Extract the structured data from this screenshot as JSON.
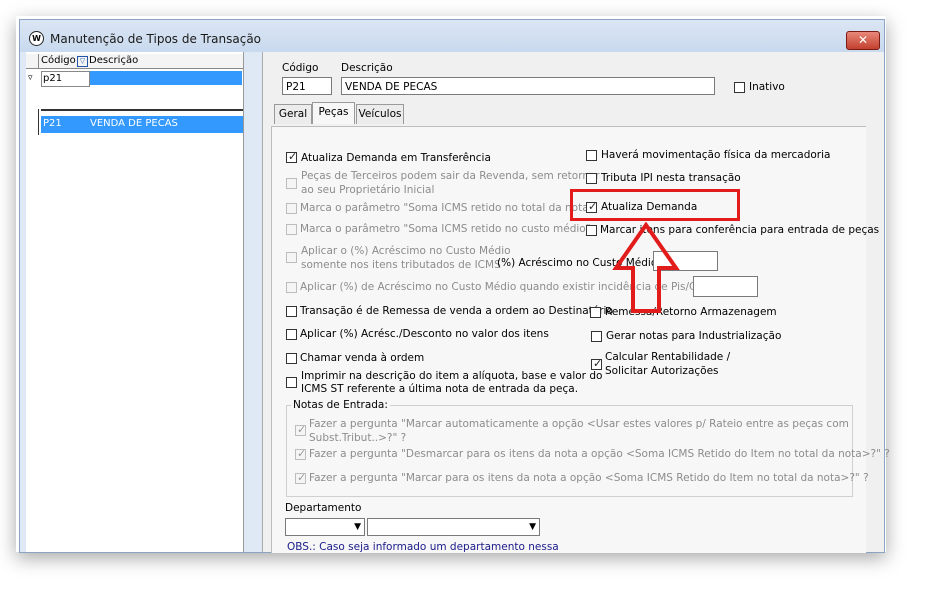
{
  "window": {
    "title": "Manutenção de Tipos de Transação",
    "close_label": "✕"
  },
  "list": {
    "col_codigo": "Código",
    "col_descricao": "Descrição",
    "filter_value": "p21",
    "rows": [
      {
        "codigo": "P21",
        "descricao": "VENDA DE PECAS"
      }
    ]
  },
  "header": {
    "codigo_label": "Código",
    "descricao_label": "Descrição",
    "codigo_value": "P21",
    "descricao_value": "VENDA DE PECAS",
    "inativo_label": "Inativo"
  },
  "tabs": [
    "Geral",
    "Peças",
    "Veículos"
  ],
  "active_tab": "Peças",
  "options": {
    "atualiza_transf": "Atualiza Demanda em Transferência",
    "pecas_terceiros_1": "Peças de Terceiros podem sair da Revenda, sem retornar",
    "pecas_terceiros_2": "ao seu Proprietário Inicial",
    "marca_soma_total": "Marca o parâmetro \"Soma ICMS retido no total da nota\"",
    "marca_soma_custo": "Marca o parâmetro \"Soma ICMS retido no custo médio\".",
    "aplicar_acresc_1": "Aplicar o (%) Acréscimo no Custo Médio",
    "aplicar_acresc_2": "somente nos itens tributados de ICMS",
    "acresc_custo_label": "(%) Acréscimo no Custo Médio:",
    "aplicar_pis": "Aplicar (%) de Acréscimo no Custo Médio quando existir incidência de Pis/Cofins:",
    "remessa_ordem": "Transação é de Remessa de venda a ordem ao Destinatário",
    "aplicar_desconto": "Aplicar (%) Acrésc./Desconto no valor dos itens",
    "chamar_venda": "Chamar venda à ordem",
    "imprimir_1": "Imprimir na descrição do item a alíquota, base e valor do",
    "imprimir_2": "ICMS ST referente a última nota de entrada da peça.",
    "movimentacao": "Haverá movimentação física da mercadoria",
    "tributa_ipi": "Tributa IPI nesta transação",
    "atualiza_demanda": "Atualiza Demanda",
    "marcar_conferencia": "Marcar itens para conferência para entrada de peças",
    "remessa_armazenagem": "Remessa/Retorno Armazenagem",
    "gerar_notas": "Gerar notas para Industrialização",
    "calcular_1": "Calcular Rentabilidade /",
    "calcular_2": "Solicitar Autorizações"
  },
  "notas": {
    "title": "Notas de Entrada:",
    "n1_1": "Fazer a pergunta \"Marcar automaticamente a opção <Usar estes valores p/ Rateio entre as peças com",
    "n1_2": "Subst.Tribut..>?\" ?",
    "n2": "Fazer a pergunta \"Desmarcar para os itens da nota a opção <Soma ICMS Retido do Item no total da nota>?\" ?",
    "n3": "Fazer a pergunta \"Marcar para os itens da nota a opção <Soma ICMS Retido do Item no total da nota>?\" ?"
  },
  "departamento": {
    "label": "Departamento",
    "obs": "OBS.: Caso seja informado um departamento nessa"
  },
  "colors": {
    "highlight": "#e21b1b",
    "selection": "#3399ff"
  }
}
